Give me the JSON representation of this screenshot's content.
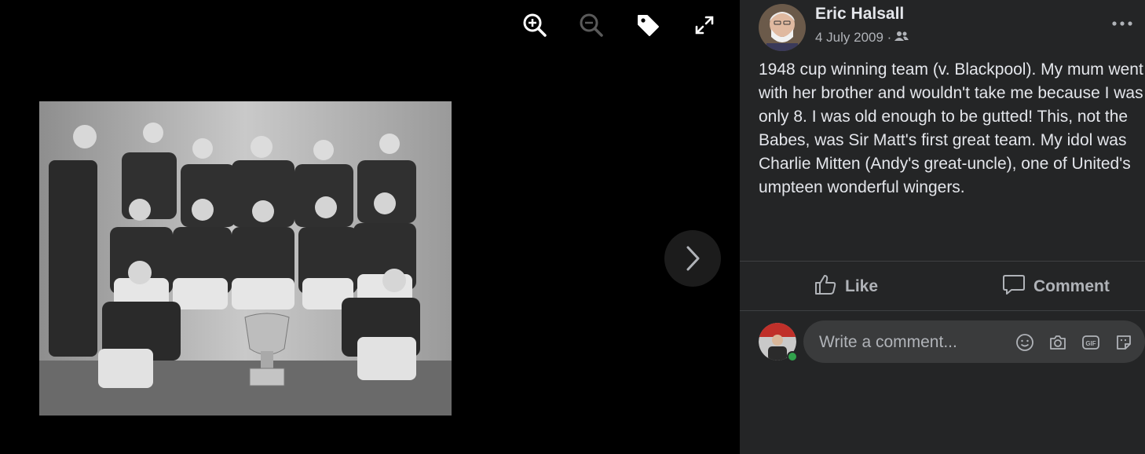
{
  "viewer": {
    "tools": [
      "zoom-in-icon",
      "zoom-out-icon",
      "tag-icon",
      "fullscreen-icon"
    ],
    "next_icon": "chevron-right-icon"
  },
  "post": {
    "author": "Eric Halsall",
    "date": "4 July 2009 ·",
    "audience_icon": "friends-icon",
    "caption": "1948 cup winning team (v. Blackpool). My mum went with her brother and wouldn't take me because I was only 8. I was old enough to be gutted! This, not the Babes, was Sir Matt's first great team. My idol was Charlie Mitten (Andy's great-uncle), one of United's umpteen wonderful wingers."
  },
  "actions": {
    "like": "Like",
    "comment": "Comment"
  },
  "comment_box": {
    "placeholder": "Write a comment...",
    "icons": [
      "emoji-icon",
      "camera-icon",
      "gif-icon",
      "sticker-icon"
    ]
  },
  "colors": {
    "panel": "#242526",
    "text": "#e4e6eb",
    "secondary": "#b0b3b8",
    "online": "#31a24c"
  }
}
